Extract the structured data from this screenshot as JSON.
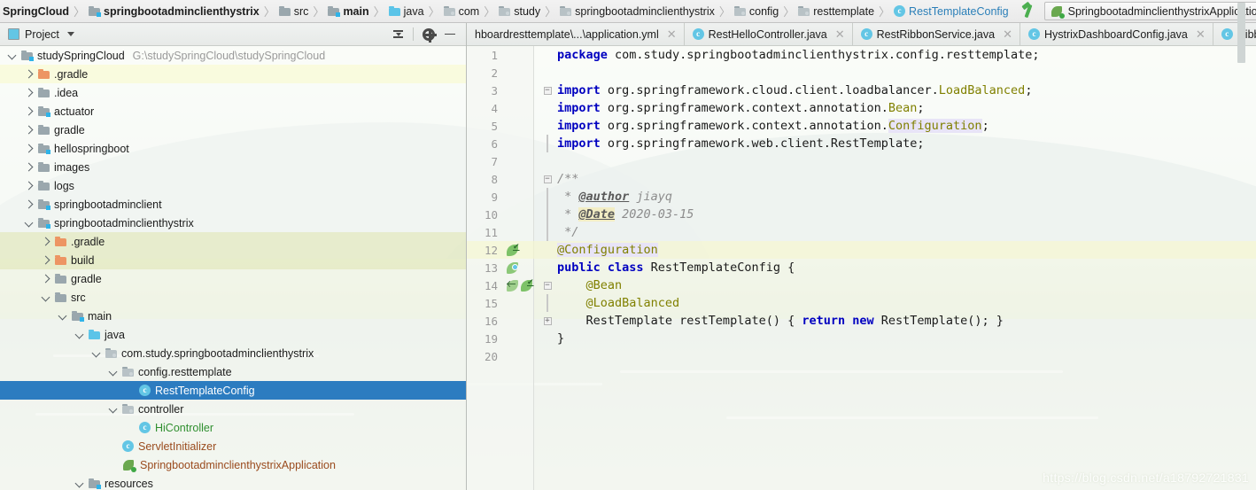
{
  "breadcrumb": {
    "items": [
      {
        "label": "SpringCloud",
        "icon": "none",
        "bold": true,
        "blue": false
      },
      {
        "label": "springbootadminclienthystrix",
        "icon": "module-folder",
        "bold": true,
        "blue": false
      },
      {
        "label": "src",
        "icon": "folder",
        "bold": false,
        "blue": false
      },
      {
        "label": "main",
        "icon": "module-folder",
        "bold": true,
        "blue": false
      },
      {
        "label": "java",
        "icon": "source-folder",
        "bold": false,
        "blue": false
      },
      {
        "label": "com",
        "icon": "package",
        "bold": false,
        "blue": false
      },
      {
        "label": "study",
        "icon": "package",
        "bold": false,
        "blue": false
      },
      {
        "label": "springbootadminclienthystrix",
        "icon": "package",
        "bold": false,
        "blue": false
      },
      {
        "label": "config",
        "icon": "package",
        "bold": false,
        "blue": false
      },
      {
        "label": "resttemplate",
        "icon": "package",
        "bold": false,
        "blue": false
      },
      {
        "label": "RestTemplateConfig",
        "icon": "java-class",
        "bold": false,
        "blue": true
      }
    ],
    "separator": "〉",
    "build_icon": "hammer-icon",
    "run_config": "SpringbootadminclienthystrixApplication"
  },
  "project_panel": {
    "title": "Project",
    "collapse_all_icon": "collapse-all-icon",
    "settings_icon": "gear-icon",
    "hide_icon": "minimize-icon",
    "tree": [
      {
        "label": "studySpringCloud",
        "path": "G:\\studySpringCloud\\studySpringCloud",
        "depth": 0,
        "twist": "down",
        "icon": "module-folder",
        "row": "plain",
        "color": "default"
      },
      {
        "label": ".gradle",
        "path": "",
        "depth": 1,
        "twist": "right",
        "icon": "orange-folder",
        "row": "hl-yellow",
        "color": "default"
      },
      {
        "label": ".idea",
        "path": "",
        "depth": 1,
        "twist": "right",
        "icon": "folder",
        "row": "plain",
        "color": "default"
      },
      {
        "label": "actuator",
        "path": "",
        "depth": 1,
        "twist": "right",
        "icon": "module-folder",
        "row": "plain",
        "color": "default"
      },
      {
        "label": "gradle",
        "path": "",
        "depth": 1,
        "twist": "right",
        "icon": "folder",
        "row": "plain",
        "color": "default"
      },
      {
        "label": "hellospringboot",
        "path": "",
        "depth": 1,
        "twist": "right",
        "icon": "module-folder",
        "row": "plain",
        "color": "default"
      },
      {
        "label": "images",
        "path": "",
        "depth": 1,
        "twist": "right",
        "icon": "folder",
        "row": "plain",
        "color": "default"
      },
      {
        "label": "logs",
        "path": "",
        "depth": 1,
        "twist": "right",
        "icon": "folder",
        "row": "plain",
        "color": "default"
      },
      {
        "label": "springbootadminclient",
        "path": "",
        "depth": 1,
        "twist": "right",
        "icon": "module-folder",
        "row": "plain",
        "color": "default"
      },
      {
        "label": "springbootadminclienthystrix",
        "path": "",
        "depth": 1,
        "twist": "down",
        "icon": "module-folder",
        "row": "plain",
        "color": "default"
      },
      {
        "label": ".gradle",
        "path": "",
        "depth": 2,
        "twist": "right",
        "icon": "orange-folder",
        "row": "hl-olive",
        "color": "default"
      },
      {
        "label": "build",
        "path": "",
        "depth": 2,
        "twist": "right",
        "icon": "orange-folder",
        "row": "hl-olive",
        "color": "default"
      },
      {
        "label": "gradle",
        "path": "",
        "depth": 2,
        "twist": "right",
        "icon": "folder",
        "row": "plain",
        "color": "default"
      },
      {
        "label": "src",
        "path": "",
        "depth": 2,
        "twist": "down",
        "icon": "folder",
        "row": "plain",
        "color": "default"
      },
      {
        "label": "main",
        "path": "",
        "depth": 3,
        "twist": "down",
        "icon": "module-folder",
        "row": "plain",
        "color": "default"
      },
      {
        "label": "java",
        "path": "",
        "depth": 4,
        "twist": "down",
        "icon": "source-folder",
        "row": "plain",
        "color": "default"
      },
      {
        "label": "com.study.springbootadminclienthystrix",
        "path": "",
        "depth": 5,
        "twist": "down",
        "icon": "package",
        "row": "plain",
        "color": "default"
      },
      {
        "label": "config.resttemplate",
        "path": "",
        "depth": 6,
        "twist": "down",
        "icon": "package",
        "row": "plain",
        "color": "default"
      },
      {
        "label": "RestTemplateConfig",
        "path": "",
        "depth": 7,
        "twist": "none",
        "icon": "java-class",
        "row": "selected",
        "color": "default"
      },
      {
        "label": "controller",
        "path": "",
        "depth": 6,
        "twist": "down",
        "icon": "package",
        "row": "plain",
        "color": "default"
      },
      {
        "label": "HiController",
        "path": "",
        "depth": 7,
        "twist": "none",
        "icon": "java-class",
        "row": "plain",
        "color": "green"
      },
      {
        "label": "ServletInitializer",
        "path": "",
        "depth": 6,
        "twist": "none",
        "icon": "java-class",
        "row": "plain",
        "color": "brown"
      },
      {
        "label": "SpringbootadminclienthystrixApplication",
        "path": "",
        "depth": 6,
        "twist": "none",
        "icon": "spring-class",
        "row": "plain",
        "color": "brown"
      },
      {
        "label": "resources",
        "path": "",
        "depth": 4,
        "twist": "down",
        "icon": "resource-folder",
        "row": "plain",
        "color": "default"
      }
    ]
  },
  "editor_tabs": [
    {
      "label": "hboardresttemplate\\...\\application.yml",
      "icon": "none",
      "active": false,
      "close": "✕"
    },
    {
      "label": "RestHelloController.java",
      "icon": "java-class",
      "active": false,
      "close": "✕"
    },
    {
      "label": "RestRibbonService.java",
      "icon": "java-class",
      "active": false,
      "close": "✕"
    },
    {
      "label": "HystrixDashboardConfig.java",
      "icon": "java-class",
      "active": false,
      "close": "✕"
    },
    {
      "label": "Ribbon",
      "icon": "java-class",
      "active": false,
      "close": ""
    }
  ],
  "editor": {
    "lines": [
      {
        "num": "1",
        "cur": false,
        "gutter": [],
        "fold": "",
        "tokens": [
          {
            "t": "package ",
            "c": "kw"
          },
          {
            "t": "com.study.springbootadminclienthystrix.config.resttemplate;",
            "c": "plain"
          }
        ]
      },
      {
        "num": "2",
        "cur": false,
        "gutter": [],
        "fold": "",
        "tokens": []
      },
      {
        "num": "3",
        "cur": false,
        "gutter": [],
        "fold": "top",
        "tokens": [
          {
            "t": "import ",
            "c": "kw"
          },
          {
            "t": "org.springframework.cloud.client.loadbalancer.",
            "c": "plain"
          },
          {
            "t": "LoadBalanced",
            "c": "anno"
          },
          {
            "t": ";",
            "c": "plain"
          }
        ]
      },
      {
        "num": "4",
        "cur": false,
        "gutter": [],
        "fold": "",
        "tokens": [
          {
            "t": "import ",
            "c": "kw"
          },
          {
            "t": "org.springframework.context.annotation.",
            "c": "plain"
          },
          {
            "t": "Bean",
            "c": "anno"
          },
          {
            "t": ";",
            "c": "plain"
          }
        ]
      },
      {
        "num": "5",
        "cur": false,
        "gutter": [],
        "fold": "",
        "tokens": [
          {
            "t": "import ",
            "c": "kw"
          },
          {
            "t": "org.springframework.context.annotation.",
            "c": "plain"
          },
          {
            "t": "Configuration",
            "c": "anno anno-hl"
          },
          {
            "t": ";",
            "c": "plain"
          }
        ]
      },
      {
        "num": "6",
        "cur": false,
        "gutter": [],
        "fold": "bot",
        "tokens": [
          {
            "t": "import ",
            "c": "kw"
          },
          {
            "t": "org.springframework.web.client.RestTemplate;",
            "c": "plain"
          }
        ]
      },
      {
        "num": "7",
        "cur": false,
        "gutter": [],
        "fold": "",
        "tokens": []
      },
      {
        "num": "8",
        "cur": false,
        "gutter": [],
        "fold": "top",
        "tokens": [
          {
            "t": "/**",
            "c": "cmt"
          }
        ]
      },
      {
        "num": "9",
        "cur": false,
        "gutter": [],
        "fold": "line",
        "tokens": [
          {
            "t": " * ",
            "c": "cmt"
          },
          {
            "t": "@author",
            "c": "cmt-tag"
          },
          {
            "t": " jiayq",
            "c": "cmt"
          }
        ]
      },
      {
        "num": "10",
        "cur": false,
        "gutter": [],
        "fold": "line",
        "tokens": [
          {
            "t": " * ",
            "c": "cmt"
          },
          {
            "t": "@Date",
            "c": "cmt-tag hly"
          },
          {
            "t": " 2020-03-15",
            "c": "cmt"
          }
        ]
      },
      {
        "num": "11",
        "cur": false,
        "gutter": [],
        "fold": "bot",
        "tokens": [
          {
            "t": " */",
            "c": "cmt"
          }
        ]
      },
      {
        "num": "12",
        "cur": true,
        "gutter": [
          "leaf-check"
        ],
        "fold": "",
        "tokens": [
          {
            "t": "@Configuration",
            "c": "anno anno-hl"
          }
        ]
      },
      {
        "num": "13",
        "cur": false,
        "gutter": [
          "leaf-bean"
        ],
        "fold": "",
        "tokens": [
          {
            "t": "public class ",
            "c": "kw"
          },
          {
            "t": "RestTemplateConfig {",
            "c": "plain"
          }
        ]
      },
      {
        "num": "14",
        "cur": false,
        "gutter": [
          "leaf-arrow",
          "leaf-check"
        ],
        "fold": "top",
        "tokens": [
          {
            "t": "    @Bean",
            "c": "anno"
          }
        ]
      },
      {
        "num": "15",
        "cur": false,
        "gutter": [],
        "fold": "bot",
        "tokens": [
          {
            "t": "    @LoadBalanced",
            "c": "anno"
          }
        ]
      },
      {
        "num": "16",
        "cur": false,
        "gutter": [],
        "fold": "plus",
        "tokens": [
          {
            "t": "    RestTemplate restTemplate() { ",
            "c": "plain"
          },
          {
            "t": "return new ",
            "c": "kw"
          },
          {
            "t": "RestTemplate(); }",
            "c": "plain"
          }
        ]
      },
      {
        "num": "19",
        "cur": false,
        "gutter": [],
        "fold": "",
        "tokens": [
          {
            "t": "}",
            "c": "plain"
          }
        ]
      },
      {
        "num": "20",
        "cur": false,
        "gutter": [],
        "fold": "",
        "tokens": []
      }
    ]
  },
  "watermark": "https://blog.csdn.net/a18792721831"
}
